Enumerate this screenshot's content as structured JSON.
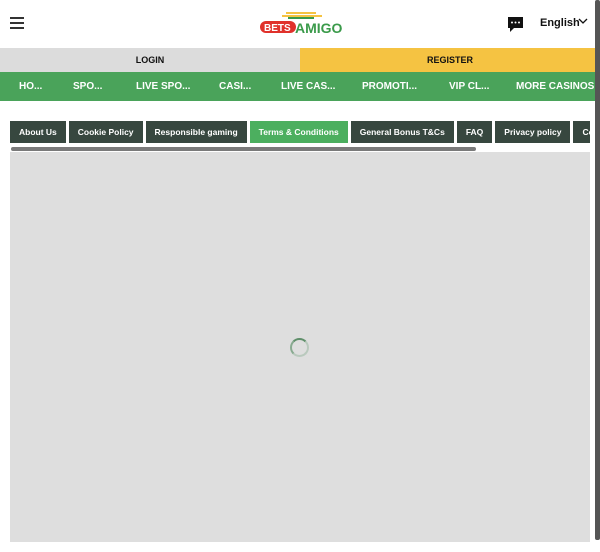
{
  "header": {
    "logo_text": "BETSAMIGO",
    "language": "English",
    "icons": {
      "menu": "hamburger-icon",
      "chat": "chat-icon",
      "language": "chevron-down-icon"
    }
  },
  "auth": {
    "login": "LOGIN",
    "register": "REGISTER"
  },
  "nav": [
    "HO...",
    "SPO...",
    "LIVE SPO...",
    "CASI...",
    "LIVE CAS...",
    "PROMOTI...",
    "VIP CL...",
    "MORE CASINOS"
  ],
  "tabs": [
    {
      "label": "About Us"
    },
    {
      "label": "Cookie Policy"
    },
    {
      "label": "Responsible gaming"
    },
    {
      "label": "Terms & Conditions",
      "active": true
    },
    {
      "label": "General Bonus T&Cs"
    },
    {
      "label": "FAQ"
    },
    {
      "label": "Privacy policy"
    },
    {
      "label": "Co"
    }
  ],
  "colors": {
    "nav_green": "#4aa35a",
    "register_yellow": "#f5c342",
    "tab_dark": "#37473f",
    "tab_active": "#4caf5f",
    "logo_red": "#e0312b"
  }
}
